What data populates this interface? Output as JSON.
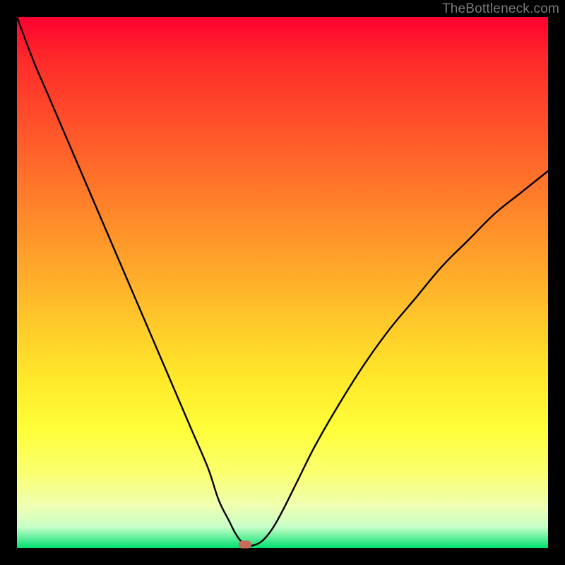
{
  "watermark": "TheBottleneck.com",
  "chart_data": {
    "type": "line",
    "title": "",
    "xlabel": "",
    "ylabel": "",
    "xlim": [
      0,
      100
    ],
    "ylim": [
      0,
      100
    ],
    "grid": false,
    "legend": false,
    "series": [
      {
        "name": "curve",
        "color": "#000000",
        "x": [
          0,
          3,
          6,
          9,
          12,
          15,
          18,
          21,
          24,
          27,
          30,
          33,
          36,
          38,
          40,
          41,
          42,
          43,
          44,
          46,
          48,
          50,
          53,
          56,
          60,
          65,
          70,
          75,
          80,
          85,
          90,
          95,
          100
        ],
        "y": [
          100,
          92,
          85,
          78,
          71,
          64,
          57,
          50,
          43,
          36,
          29,
          22,
          15,
          9,
          5,
          3,
          1.5,
          0.6,
          0.4,
          1.2,
          3.5,
          7,
          13,
          19,
          26,
          34,
          41,
          47,
          53,
          58,
          63,
          67,
          71
        ]
      }
    ],
    "marker": {
      "x": 43,
      "y": 0.6,
      "color": "#c96a5a"
    },
    "background_gradient": {
      "top": "#ff0030",
      "mid": "#ffe82a",
      "bottom": "#00e070"
    }
  }
}
